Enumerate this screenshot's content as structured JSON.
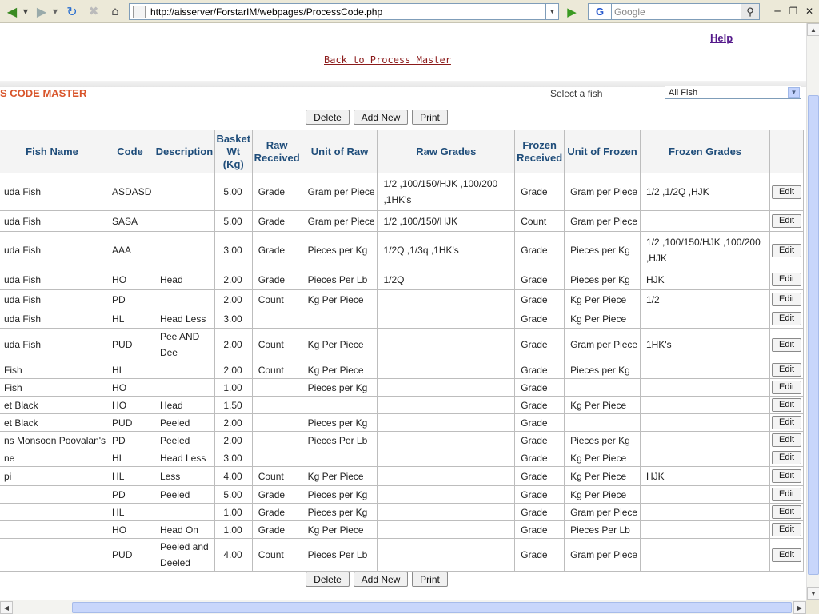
{
  "browser": {
    "url": "http://aisserver/ForstarIM/webpages/ProcessCode.php",
    "search_placeholder": "Google",
    "search_engine_label": "G"
  },
  "page": {
    "help_label": "Help",
    "back_link_label": "Back to Process Master",
    "title": "S CODE MASTER",
    "select_fish_label": "Select a fish",
    "select_fish_value": "All Fish"
  },
  "buttons": {
    "delete": "Delete",
    "add_new": "Add New",
    "print": "Print",
    "edit": "Edit"
  },
  "table": {
    "headers": [
      "Fish Name",
      "Code",
      "Description",
      "Basket Wt (Kg)",
      "Raw Received",
      "Unit of Raw",
      "Raw Grades",
      "Frozen Received",
      "Unit of Frozen",
      "Frozen Grades",
      ""
    ],
    "rows": [
      [
        "uda Fish",
        "ASDASD",
        "",
        "5.00",
        "Grade",
        "Gram per Piece",
        "1/2       ,100/150/HJK ,100/200 ,1HK's",
        "Grade",
        "Gram per Piece",
        "1/2 ,1/2Q ,HJK"
      ],
      [
        "uda Fish",
        "SASA",
        "",
        "5.00",
        "Grade",
        "Gram per Piece",
        "1/2 ,100/150/HJK",
        "Count",
        "Gram per Piece",
        ""
      ],
      [
        "uda Fish",
        "AAA",
        "",
        "3.00",
        "Grade",
        "Pieces per Kg",
        "1/2Q ,1/3q ,1HK's",
        "Grade",
        "Pieces per Kg",
        "1/2     ,100/150/HJK ,100/200 ,HJK"
      ],
      [
        "uda Fish",
        "HO",
        "Head",
        "2.00",
        "Grade",
        "Pieces Per Lb",
        "1/2Q",
        "Grade",
        "Pieces per Kg",
        "HJK"
      ],
      [
        "uda Fish",
        "PD",
        "",
        "2.00",
        "Count",
        "Kg Per Piece",
        "",
        "Grade",
        "Kg Per Piece",
        "1/2"
      ],
      [
        "uda Fish",
        "HL",
        "Head Less",
        "3.00",
        "",
        "",
        "",
        "Grade",
        "Kg Per Piece",
        ""
      ],
      [
        "uda Fish",
        "PUD",
        "Pee AND Dee",
        "2.00",
        "Count",
        "Kg Per Piece",
        "",
        "Grade",
        "Gram per Piece",
        "1HK's"
      ],
      [
        "Fish",
        "HL",
        "",
        "2.00",
        "Count",
        "Kg Per Piece",
        "",
        "Grade",
        "Pieces per Kg",
        ""
      ],
      [
        "Fish",
        "HO",
        "",
        "1.00",
        "",
        "Pieces per Kg",
        "",
        "Grade",
        "",
        ""
      ],
      [
        "et Black",
        "HO",
        "Head",
        "1.50",
        "",
        "",
        "",
        "Grade",
        "Kg Per Piece",
        ""
      ],
      [
        "et Black",
        "PUD",
        "Peeled",
        "2.00",
        "",
        "Pieces per Kg",
        "",
        "Grade",
        "",
        ""
      ],
      [
        "ns Monsoon Poovalan's",
        "PD",
        "Peeled",
        "2.00",
        "",
        "Pieces Per Lb",
        "",
        "Grade",
        "Pieces per Kg",
        ""
      ],
      [
        "ne",
        "HL",
        "Head Less",
        "3.00",
        "",
        "",
        "",
        "Grade",
        "Kg Per Piece",
        ""
      ],
      [
        "pi",
        "HL",
        "Less",
        "4.00",
        "Count",
        "Kg Per Piece",
        "",
        "Grade",
        "Kg Per Piece",
        "HJK"
      ],
      [
        "",
        "PD",
        "Peeled",
        "5.00",
        "Grade",
        "Pieces per Kg",
        "",
        "Grade",
        "Kg Per Piece",
        ""
      ],
      [
        "",
        "HL",
        "",
        "1.00",
        "Grade",
        "Pieces per Kg",
        "",
        "Grade",
        "Gram per Piece",
        ""
      ],
      [
        "",
        "HO",
        "Head On",
        "1.00",
        "Grade",
        "Kg Per Piece",
        "",
        "Grade",
        "Pieces Per Lb",
        ""
      ],
      [
        "",
        "PUD",
        "Peeled and Deeled",
        "4.00",
        "Count",
        "Pieces Per Lb",
        "",
        "Grade",
        "Gram per Piece",
        ""
      ]
    ]
  }
}
